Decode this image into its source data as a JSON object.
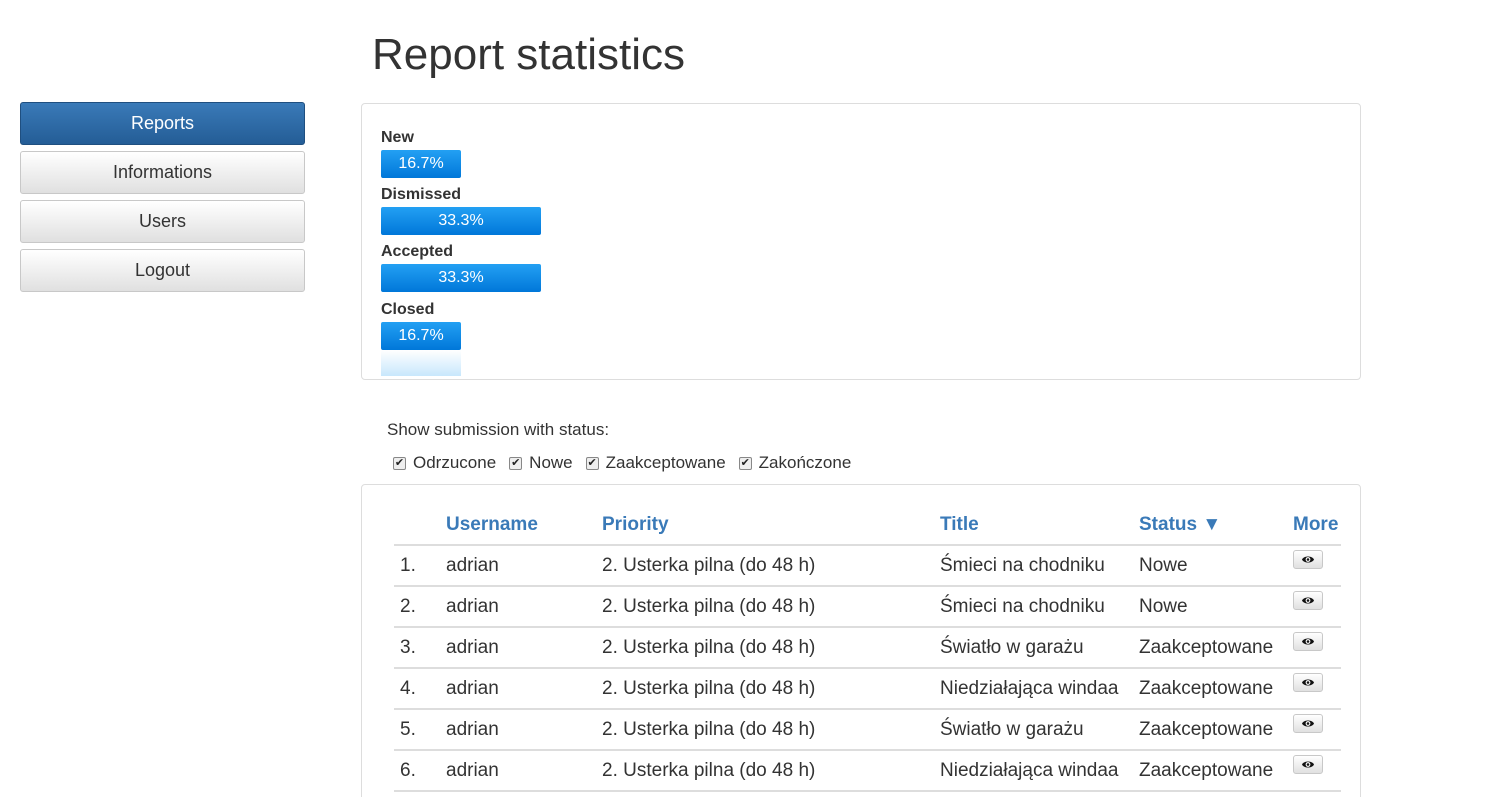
{
  "sidebar": {
    "items": [
      {
        "label": "Reports",
        "active": true
      },
      {
        "label": "Informations"
      },
      {
        "label": "Users"
      },
      {
        "label": "Logout"
      }
    ]
  },
  "page_title": "Report statistics",
  "stats": [
    {
      "label": "New",
      "value": "16.7%",
      "fraction": 0.167
    },
    {
      "label": "Dismissed",
      "value": "33.3%",
      "fraction": 0.333
    },
    {
      "label": "Accepted",
      "value": "33.3%",
      "fraction": 0.333
    },
    {
      "label": "Closed",
      "value": "16.7%",
      "fraction": 0.167
    }
  ],
  "filter": {
    "title": "Show submission with status:",
    "options": [
      {
        "label": "Odrzucone",
        "checked": true
      },
      {
        "label": "Nowe",
        "checked": true
      },
      {
        "label": "Zaakceptowane",
        "checked": true
      },
      {
        "label": "Zakończone",
        "checked": true
      }
    ]
  },
  "table": {
    "headers": {
      "index": "",
      "username": "Username",
      "priority": "Priority",
      "title": "Title",
      "status": "Status ▼",
      "more": "More"
    },
    "rows": [
      {
        "index": "1.",
        "username": "adrian",
        "priority": "2. Usterka pilna (do 48 h)",
        "title": "Śmieci na chodniku",
        "status": "Nowe"
      },
      {
        "index": "2.",
        "username": "adrian",
        "priority": "2. Usterka pilna (do 48 h)",
        "title": "Śmieci na chodniku",
        "status": "Nowe"
      },
      {
        "index": "3.",
        "username": "adrian",
        "priority": "2. Usterka pilna (do 48 h)",
        "title": "Światło w garażu",
        "status": "Zaakceptowane"
      },
      {
        "index": "4.",
        "username": "adrian",
        "priority": "2. Usterka pilna (do 48 h)",
        "title": "Niedziałająca windaa",
        "status": "Zaakceptowane"
      },
      {
        "index": "5.",
        "username": "adrian",
        "priority": "2. Usterka pilna (do 48 h)",
        "title": "Światło w garażu",
        "status": "Zaakceptowane"
      },
      {
        "index": "6.",
        "username": "adrian",
        "priority": "2. Usterka pilna (do 48 h)",
        "title": "Niedziałająca windaa",
        "status": "Zaakceptowane"
      }
    ]
  },
  "icons": {
    "row_action": "eye-icon",
    "filter_checkbox": "checkbox-checked-icon"
  }
}
